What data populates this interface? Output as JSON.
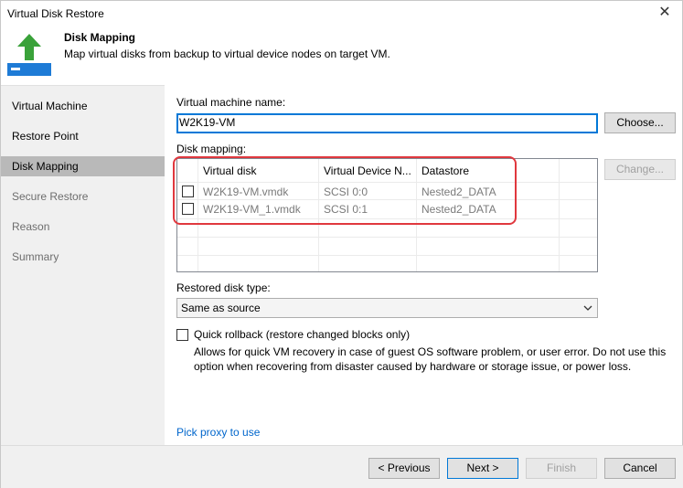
{
  "window": {
    "title": "Virtual Disk Restore"
  },
  "header": {
    "title": "Disk Mapping",
    "subtitle": "Map virtual disks from backup to virtual device nodes on target VM."
  },
  "sidebar": {
    "items": [
      {
        "label": "Virtual Machine",
        "state": "done"
      },
      {
        "label": "Restore Point",
        "state": "done"
      },
      {
        "label": "Disk Mapping",
        "state": "active"
      },
      {
        "label": "Secure Restore",
        "state": "pending"
      },
      {
        "label": "Reason",
        "state": "pending"
      },
      {
        "label": "Summary",
        "state": "pending"
      }
    ]
  },
  "vm": {
    "label": "Virtual machine name:",
    "value": "W2K19-VM",
    "choose_label": "Choose..."
  },
  "mapping": {
    "label": "Disk mapping:",
    "change_label": "Change...",
    "columns": [
      "Virtual disk",
      "Virtual Device N...",
      "Datastore"
    ],
    "rows": [
      {
        "checked": false,
        "disk": "W2K19-VM.vmdk",
        "device": "SCSI 0:0",
        "datastore": "Nested2_DATA"
      },
      {
        "checked": false,
        "disk": "W2K19-VM_1.vmdk",
        "device": "SCSI 0:1",
        "datastore": "Nested2_DATA"
      }
    ]
  },
  "disk_type": {
    "label": "Restored disk type:",
    "selected": "Same as source"
  },
  "quick_rollback": {
    "checked": false,
    "label": "Quick rollback (restore changed blocks only)",
    "description": "Allows for quick VM recovery in case of guest OS software problem, or user error. Do not use this option when recovering from disaster caused by hardware or storage issue, or power loss."
  },
  "proxy_link": "Pick proxy to use",
  "footer": {
    "previous": "< Previous",
    "next": "Next >",
    "finish": "Finish",
    "cancel": "Cancel"
  },
  "colors": {
    "accent": "#0078d7",
    "link": "#0066cc",
    "highlight": "#e0383e",
    "icon_green": "#3aa23a",
    "icon_blue": "#1e7bd6"
  },
  "icons": {
    "header": "restore-arrow-disk-icon",
    "close": "close-icon",
    "dropdown": "chevron-down-icon"
  }
}
